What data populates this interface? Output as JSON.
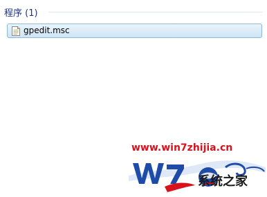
{
  "results": {
    "group_title": "程序 (1)",
    "items": [
      {
        "label": "gpedit.msc",
        "icon": "msc-file-icon",
        "selected": true
      }
    ]
  },
  "watermark": {
    "url": "www.win7zhijia.cn",
    "brand": "系统之家",
    "logo_text": "W7",
    "colors": {
      "url": "#d8121c",
      "logo_blue": "#1e4aa8",
      "logo_red": "#d8121c"
    }
  }
}
